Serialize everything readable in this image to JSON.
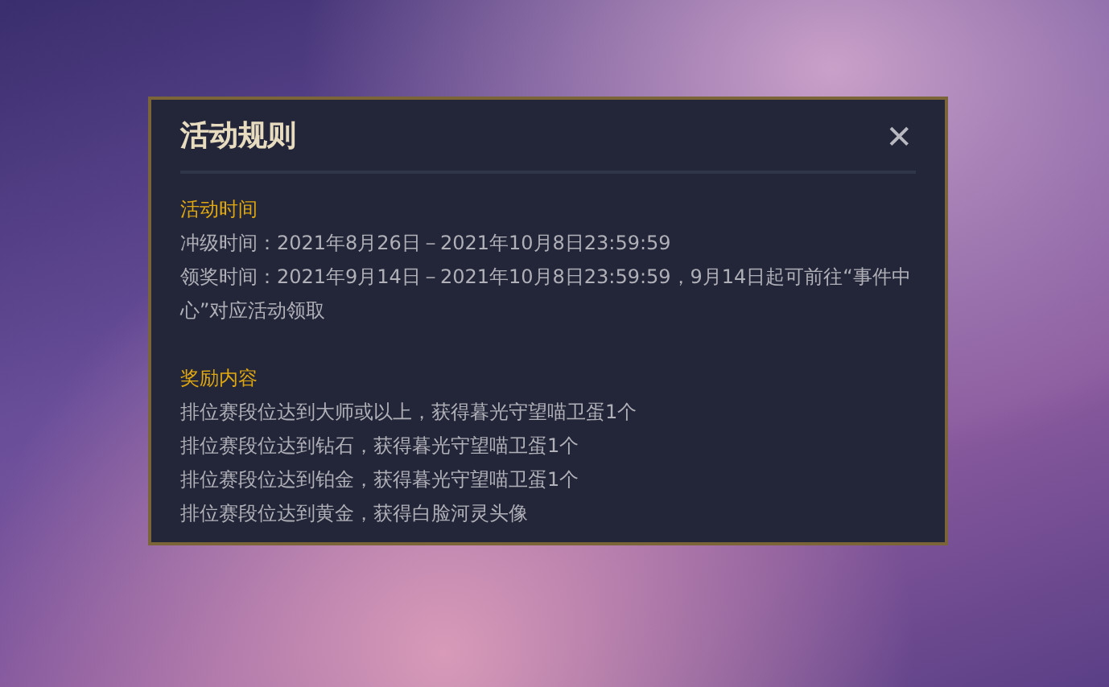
{
  "dialog": {
    "title": "活动规则",
    "close": "✕",
    "sections": [
      {
        "heading": "活动时间",
        "lines": [
          "冲级时间：2021年8月26日－2021年10月8日23:59:59",
          "领奖时间：2021年9月14日－2021年10月8日23:59:59，9月14日起可前往“事件中心”对应活动领取"
        ]
      },
      {
        "heading": "奖励内容",
        "lines": [
          "排位赛段位达到大师或以上，获得暮光守望喵卫蛋1个",
          "排位赛段位达到钻石，获得暮光守望喵卫蛋1个",
          "排位赛段位达到铂金，获得暮光守望喵卫蛋1个",
          "排位赛段位达到黄金，获得白脸河灵头像"
        ]
      }
    ]
  }
}
